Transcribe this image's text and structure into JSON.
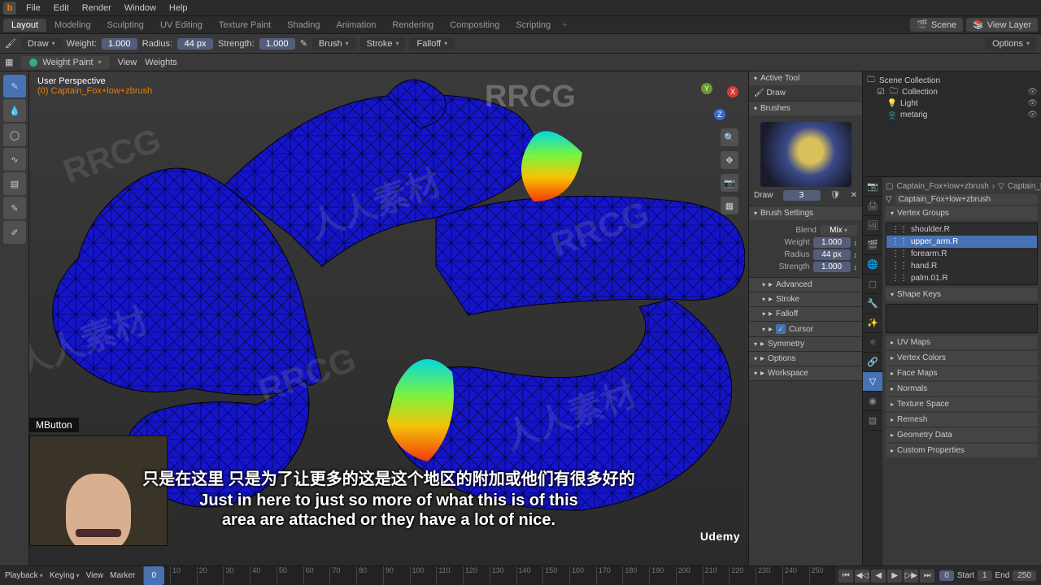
{
  "menubar": [
    "File",
    "Edit",
    "Render",
    "Window",
    "Help"
  ],
  "workspaces": {
    "tabs": [
      "Layout",
      "Modeling",
      "Sculpting",
      "UV Editing",
      "Texture Paint",
      "Shading",
      "Animation",
      "Rendering",
      "Compositing",
      "Scripting"
    ],
    "active": "Layout",
    "scene": "Scene",
    "viewlayer": "View Layer"
  },
  "tool_header": {
    "tool": "Draw",
    "weight_label": "Weight:",
    "weight": "1.000",
    "radius_label": "Radius:",
    "radius": "44 px",
    "strength_label": "Strength:",
    "strength": "1.000",
    "brush": "Brush",
    "stroke": "Stroke",
    "falloff": "Falloff",
    "options": "Options"
  },
  "header2": {
    "mode": "Weight Paint",
    "view": "View",
    "weights": "Weights"
  },
  "overlay": {
    "persp": "User Perspective",
    "obj": "(0) Captain_Fox+low+zbrush"
  },
  "left_tools": [
    {
      "name": "draw-tool",
      "active": true,
      "glyph": "✎"
    },
    {
      "name": "blur-tool",
      "active": false,
      "glyph": "💧"
    },
    {
      "name": "average-tool",
      "active": false,
      "glyph": "◯"
    },
    {
      "name": "smear-tool",
      "active": false,
      "glyph": "∿"
    },
    {
      "name": "gradient-tool",
      "active": false,
      "glyph": "▤"
    },
    {
      "name": "sample-tool",
      "active": false,
      "glyph": "✎"
    },
    {
      "name": "annotate-tool",
      "active": false,
      "glyph": "✐"
    }
  ],
  "view_icons": [
    {
      "name": "zoom-icon",
      "glyph": "🔍"
    },
    {
      "name": "move-icon",
      "glyph": "✥"
    },
    {
      "name": "camera-icon",
      "glyph": "📷"
    },
    {
      "name": "persp-icon",
      "glyph": "▦"
    }
  ],
  "npanel": {
    "active_tool": "Active Tool",
    "tool_name": "Draw",
    "brushes": "Brushes",
    "brush_name": "Draw",
    "brush_num": "3",
    "brush_settings": "Brush Settings",
    "blend_label": "Blend",
    "blend_value": "Mix",
    "weight_label": "Weight",
    "weight": "1.000",
    "radius_label": "Radius",
    "radius": "44 px",
    "strength_label": "Strength",
    "strength": "1.000",
    "advanced": "Advanced",
    "stroke": "Stroke",
    "falloff": "Falloff",
    "cursor": "Cursor",
    "symmetry": "Symmetry",
    "options": "Options",
    "workspace": "Workspace"
  },
  "outliner": {
    "scene_coll": "Scene Collection",
    "collection": "Collection",
    "items": [
      {
        "name": "Light",
        "glyph": "💡",
        "color": "#e8a33a"
      },
      {
        "name": "metarig",
        "glyph": "웃",
        "color": "#3aa"
      }
    ]
  },
  "properties": {
    "breadcrumb1": "Captain_Fox+low+zbrush",
    "breadcrumb2": "Captain_Fox+",
    "obj_name": "Captain_Fox+low+zbrush",
    "vertex_groups": "Vertex Groups",
    "vg_items": [
      "shoulder.R",
      "upper_arm.R",
      "forearm.R",
      "hand.R",
      "palm.01.R"
    ],
    "vg_active": "upper_arm.R",
    "shape_keys": "Shape Keys",
    "sections": [
      "UV Maps",
      "Vertex Colors",
      "Face Maps",
      "Normals",
      "Texture Space",
      "Remesh",
      "Geometry Data",
      "Custom Properties"
    ]
  },
  "timeline": {
    "left": [
      "Playback",
      "Keying",
      "View",
      "Marker"
    ],
    "current": "0",
    "ticks": [
      0,
      10,
      20,
      30,
      40,
      50,
      60,
      70,
      80,
      90,
      100,
      110,
      120,
      130,
      140,
      150,
      160,
      170,
      180,
      190,
      200,
      210,
      220,
      230,
      240,
      250
    ],
    "right_labels": {
      "start": "Start",
      "end": "End"
    },
    "right_values": {
      "b": "0",
      "start": "1",
      "end": "250"
    }
  },
  "webcam_label": "MButton",
  "subtitles": {
    "cn": "只是在这里 只是为了让更多的这是这个地区的附加或他们有很多好的",
    "en1": "Just in here to just so more of what this is of this",
    "en2": "area are attached or they have a lot of nice."
  },
  "udemy": "Udemy"
}
